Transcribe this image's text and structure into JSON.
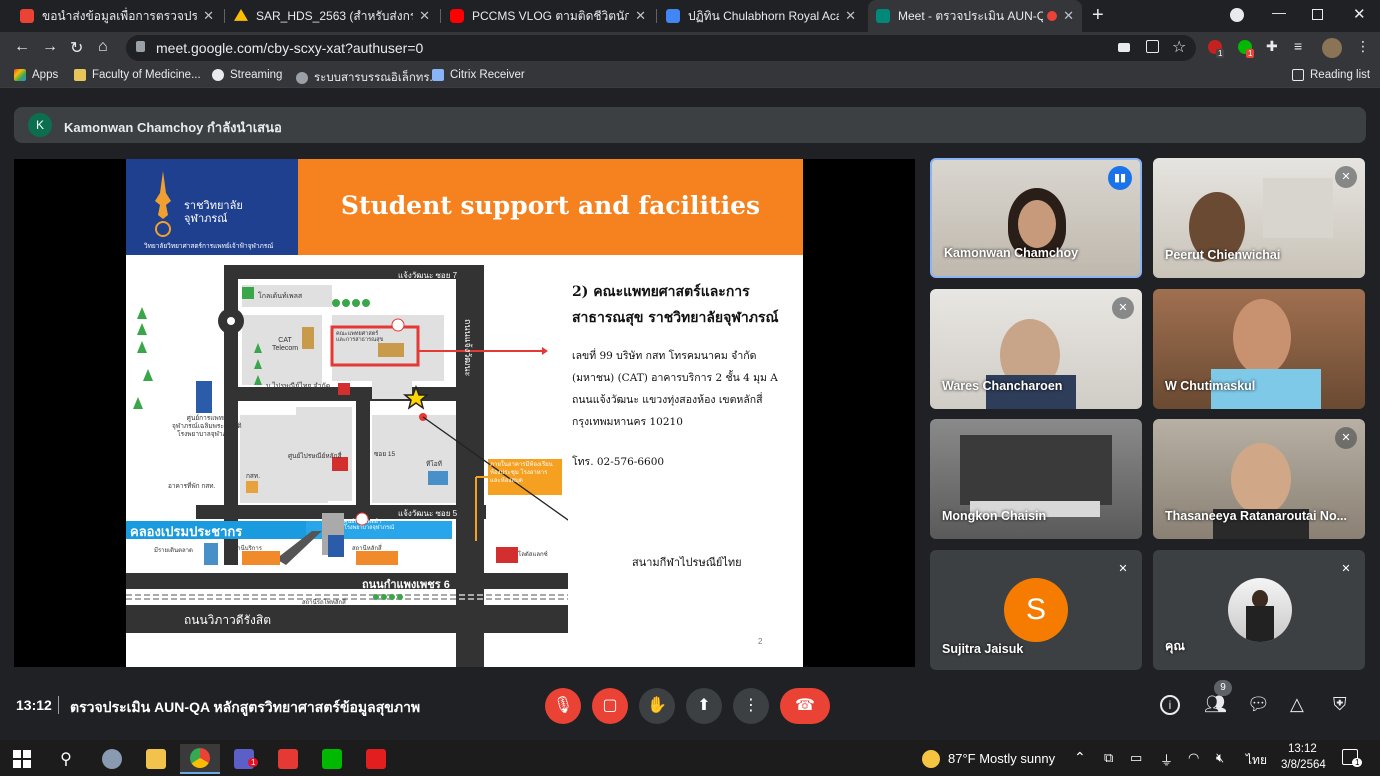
{
  "browser": {
    "tabs": [
      {
        "label": "ขอนำส่งข้อมูลเพื่อการตรวจประเมินคุณ",
        "favicon_color": "#ea4335"
      },
      {
        "label": "SAR_HDS_2563 (สำหรับส่งกรรมการ",
        "favicon_color": "#fbbc04"
      },
      {
        "label": "PCCMS VLOG ตามติดชีวิตนักศึกษาฯ",
        "favicon_color": "#ff0000"
      },
      {
        "label": "ปฏิทิน Chulabhorn Royal Academ",
        "favicon_color": "#4285f4"
      },
      {
        "label": "Meet - ตรวจประเมิน AUN-QA",
        "favicon_color": "#00897b"
      }
    ],
    "url": "meet.google.com/cby-scxy-xat?authuser=0",
    "bookmarks": [
      {
        "label": "Apps",
        "color": "#ea4335"
      },
      {
        "label": "Faculty of Medicine...",
        "color": "#e8c55a"
      },
      {
        "label": "Streaming",
        "color": "#e8eaed"
      },
      {
        "label": "ระบบสารบรรณอิเล็กทร...",
        "color": "#9aa0a6"
      },
      {
        "label": "Citrix Receiver",
        "color": "#8ab4f8"
      }
    ],
    "reading_list": "Reading list",
    "ext_badges": [
      "1",
      "1"
    ]
  },
  "meet": {
    "presenter_initial": "K",
    "presenter_text": "Kamonwan Chamchoy กำลังนำเสนอ",
    "time": "13:12",
    "meeting_title": "ตรวจประเมิน AUN-QA หลักสูตรวิทยาศาสตร์ข้อมูลสุขภาพ",
    "people_count": "9",
    "participants": [
      {
        "name": "Kamonwan Chamchoy",
        "speaking": true
      },
      {
        "name": "Peerut Chienwichai",
        "muted": true
      },
      {
        "name": "Wares Chancharoen",
        "muted": true
      },
      {
        "name": "W Chutimaskul"
      },
      {
        "name": "Mongkon Chaisin"
      },
      {
        "name": "Thasaneeya Ratanaroutai No...",
        "muted": true
      },
      {
        "name": "Sujitra Jaisuk",
        "initial": "S",
        "muted": true
      },
      {
        "name": "คุณ",
        "muted": true
      }
    ]
  },
  "slide": {
    "logo_text": "ราชวิทยาลัย\nจุฬาภรณ์",
    "logo_sub": "วิทยาลัยวิทยาศาสตร์การแพทย์เจ้าฟ้าจุฬาภรณ์",
    "title": "Student support and facilities",
    "heading": "2) คณะแพทยศาสตร์และการ\nสาธารณสุข ราชวิทยาลัยจุฬาภรณ์",
    "address": "เลขที่ 99 บริษัท กสท โทรคมนาคม จำกัด\n(มหาชน) (CAT) อาคารบริการ 2 ชั้น 4 มุม A\nถนนแจ้งวัฒนะ แขวงทุ่งสองห้อง เขตหลักสี่\nกรุงเทพมหานคร 10210",
    "phone": "โทร. 02-576-6600",
    "stadium": "สนามกีฬาไปรษณีย์ไทย",
    "page_number": "2",
    "map": {
      "soi7": "แจ้งวัฒนะ ซอย 7",
      "soi5": "แจ้งวัฒนะ ซอย 5",
      "soi15": "ซอย 15",
      "road_v": "ถนนแจ้งวัฒนะ",
      "road_kamphaeng": "ถนนกำแพงเพชร 6",
      "road_vibhavadi": "ถนนวิภาวดีรังสิต",
      "canal": "คลองเปรมประชากร",
      "school": "โกลเด้นท์เพลส",
      "cat": "CAT\nTelecom",
      "faculty_box": "คณะแพทยศาสตร์\nและการสาธารณสุข",
      "post": "บ.ไปรษณีย์ไทย จำกัด",
      "govt_center": "ศูนย์การแพทย์\nจุฬาภรณ์เฉลิมพระเกียรติ\nโรงพยาบาลจุฬาภรณ์",
      "post_center": "ศูนย์ไปรษณีย์หลักสี่",
      "tot": "ทีโอที",
      "cat2": "กสท.",
      "dorm": "อาคารที่พัก กสท.",
      "orange_note": "ภายในอาคารมีห้องเรียน\nห้องประชุม โรงอาหาร\nและห้องสมุด",
      "hospital": "ศูนย์การแพทย์ฯ\nโรงพยาบาลจุฬาภรณ์",
      "station1": "สถานีรถไฟหลักสี่",
      "station2": "สถานีหลักสี่",
      "market": "มีรายเดินตลาด",
      "lotus": "โลตัสแลกซ์",
      "chula_station": "สถานีบริการ"
    }
  },
  "taskbar": {
    "weather": "87°F  Mostly sunny",
    "lang": "ไทย",
    "time": "13:12",
    "date": "3/8/2564",
    "notif_count": "1",
    "teams_badge": "1"
  }
}
